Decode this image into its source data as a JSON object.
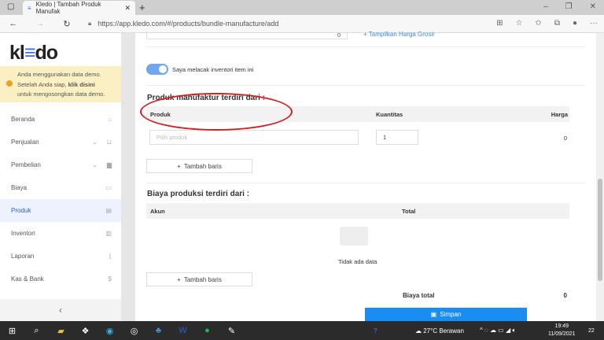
{
  "browser": {
    "tab_title": "Kledo | Tambah Produk Manufak",
    "url": "https://app.kledo.com/#/products/bundle-manufacture/add"
  },
  "sidebar": {
    "logo": "kledo",
    "demo_line1": "Anda menggunakan data demo.",
    "demo_line2_pre": "Setelah Anda siap, ",
    "demo_link": "klik disini",
    "demo_line3": "untuk mengosongkan data demo.",
    "items": [
      {
        "label": "Beranda",
        "icon": "home-icon"
      },
      {
        "label": "Penjualan",
        "icon": "basket-icon"
      },
      {
        "label": "Pembelian",
        "icon": "bag-icon"
      },
      {
        "label": "Biaya",
        "icon": "card-icon"
      },
      {
        "label": "Produk",
        "icon": "box-icon",
        "active": true
      },
      {
        "label": "Inventori",
        "icon": "warehouse-icon"
      },
      {
        "label": "Laporan",
        "icon": "chart-icon"
      },
      {
        "label": "Kas & Bank",
        "icon": "dollar-icon"
      }
    ]
  },
  "main": {
    "top_value": "0",
    "wholesale_link": "+ Tampilkan Harga Grosir",
    "track_inventory_label": "Saya melacak inventori item ini",
    "track_inventory_on": true,
    "manufacture_title": "Produk manufaktur terdiri dari :",
    "manufacture_headers": [
      "Produk",
      "Kuantitas",
      "Harga"
    ],
    "product_placeholder": "Pilih produk",
    "quantity": "1",
    "price": "0",
    "add_row": "Tambah baris",
    "cost_title": "Biaya produksi terdiri dari :",
    "cost_headers": [
      "Akun",
      "Total"
    ],
    "empty": "Tidak ada data",
    "total_label": "Biaya total",
    "total_value": "0",
    "save": "Simpan"
  },
  "taskbar": {
    "weather": "27°C  Berawan",
    "time": "19:49",
    "date": "11/09/2021",
    "notifications": "22"
  }
}
